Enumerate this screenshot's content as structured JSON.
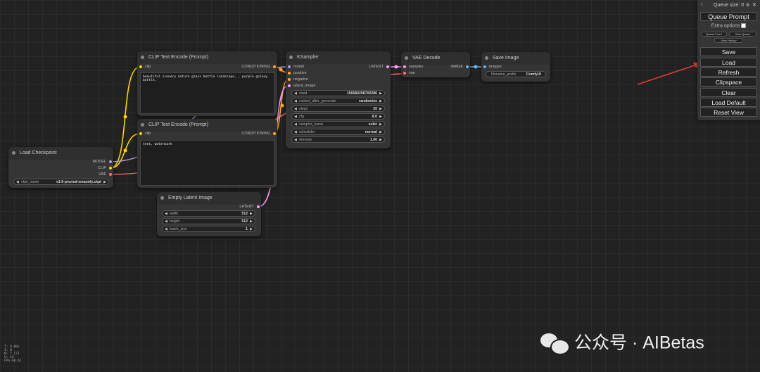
{
  "nodes": {
    "load_checkpoint": {
      "title": "Load Checkpoint",
      "outputs": [
        "MODEL",
        "CLIP",
        "VAE"
      ],
      "widget_label": "ckpt_name",
      "widget_value": "v1-5-pruned-emaonly.ckpt"
    },
    "clip_pos": {
      "title": "CLIP Text Encode (Prompt)",
      "input": "clip",
      "output": "CONDITIONING",
      "text": "beautiful scenery nature glass bottle landscape, , purple galaxy bottle,"
    },
    "clip_neg": {
      "title": "CLIP Text Encode (Prompt)",
      "input": "clip",
      "output": "CONDITIONING",
      "text": "text, watermark"
    },
    "ksampler": {
      "title": "KSampler",
      "inputs": [
        "model",
        "positive",
        "negative",
        "latent_image"
      ],
      "output": "LATENT",
      "widgets": [
        {
          "label": "seed",
          "value": "156680208700286"
        },
        {
          "label": "control_after_generate",
          "value": "randomize"
        },
        {
          "label": "steps",
          "value": "20"
        },
        {
          "label": "cfg",
          "value": "8.0"
        },
        {
          "label": "sampler_name",
          "value": "euler"
        },
        {
          "label": "scheduler",
          "value": "normal"
        },
        {
          "label": "denoise",
          "value": "1.00"
        }
      ]
    },
    "vae_decode": {
      "title": "VAE Decode",
      "inputs": [
        "samples",
        "vae"
      ],
      "output": "IMAGE"
    },
    "save_image": {
      "title": "Save Image",
      "input": "images",
      "widget_label": "filename_prefix",
      "widget_value": "ComfyUI"
    },
    "empty_latent": {
      "title": "Empty Latent Image",
      "output": "LATENT",
      "widgets": [
        {
          "label": "width",
          "value": "512"
        },
        {
          "label": "height",
          "value": "512"
        },
        {
          "label": "batch_size",
          "value": "1"
        }
      ]
    }
  },
  "panel": {
    "queue_size": "Queue size: 0",
    "queue_prompt": "Queue Prompt",
    "extra_options": "Extra options",
    "queue_front": "Queue Front",
    "view_queue": "View Queue",
    "view_history": "View History",
    "buttons": [
      "Save",
      "Load",
      "Refresh",
      "Clipspace",
      "Clear",
      "Load Default",
      "Reset View"
    ]
  },
  "stats": [
    "T: 0.00s",
    "I: 0",
    "N: 7 [7]",
    "V: 14",
    "FPS:60.61"
  ],
  "watermark": "公众号 · AIBetas",
  "colors": {
    "model": "#b39ddb",
    "clip": "#ffd500",
    "vae": "#ff6e6e",
    "conditioning": "#ffa931",
    "latent": "#ff9cf9",
    "image": "#64b5f6",
    "arrow": "#e53935"
  }
}
